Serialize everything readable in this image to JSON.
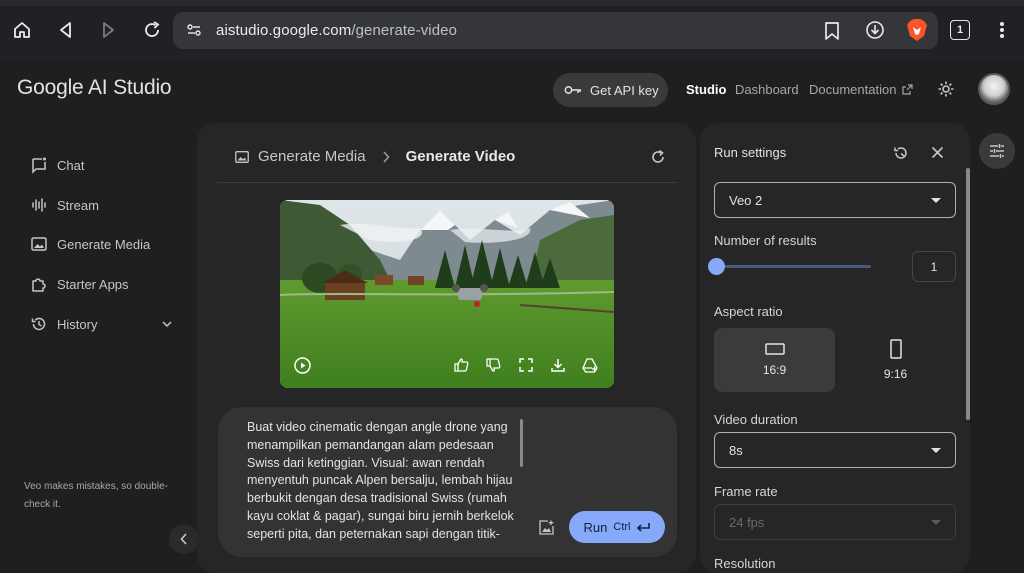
{
  "browser": {
    "url_host": "aistudio.google.com",
    "url_path": "/generate-video",
    "tab_count": "1"
  },
  "header": {
    "logo": "Google AI Studio",
    "api_key_label": "Get API key",
    "nav": {
      "studio": "Studio",
      "dashboard": "Dashboard",
      "documentation": "Documentation"
    }
  },
  "sidebar": {
    "items": [
      {
        "label": "Chat",
        "icon": "chat-icon"
      },
      {
        "label": "Stream",
        "icon": "stream-icon"
      },
      {
        "label": "Generate Media",
        "icon": "image-icon"
      },
      {
        "label": "Starter Apps",
        "icon": "puzzle-icon"
      },
      {
        "label": "History",
        "icon": "history-icon"
      }
    ],
    "disclaimer": "Veo makes mistakes, so double-check it."
  },
  "main": {
    "breadcrumb": {
      "parent": "Generate Media",
      "current": "Generate Video"
    },
    "prompt_text": "Buat video cinematic dengan angle drone yang menampilkan pemandangan alam pedesaan Swiss dari ketinggian. Visual: awan rendah menyentuh puncak Alpen bersalju, lembah hijau berbukit dengan desa tradisional Swiss (rumah kayu coklat & pagar), sungai biru jernih berkelok seperti pita, dan peternakan sapi dengan titik-",
    "run_label": "Run",
    "run_shortcut": "Ctrl"
  },
  "settings": {
    "title": "Run settings",
    "model": "Veo 2",
    "num_results_label": "Number of results",
    "num_results_value": "1",
    "aspect_ratio_label": "Aspect ratio",
    "aspect_options": [
      {
        "label": "16:9",
        "selected": true
      },
      {
        "label": "9:16",
        "selected": false
      }
    ],
    "duration_label": "Video duration",
    "duration_value": "8s",
    "frame_rate_label": "Frame rate",
    "frame_rate_value": "24 fps",
    "resolution_label": "Resolution"
  },
  "colors": {
    "accent": "#87a9f9",
    "background": "#1f1f1f",
    "panel": "#262626"
  }
}
